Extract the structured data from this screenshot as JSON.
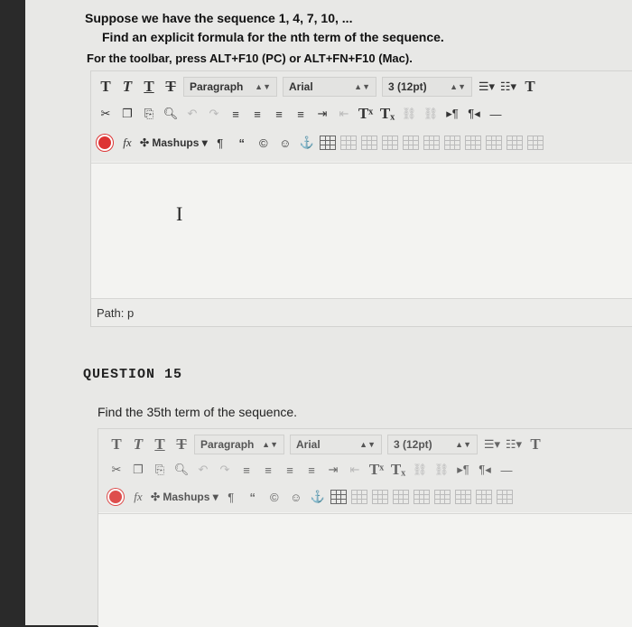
{
  "q1": {
    "line1": "Suppose we have the sequence 1, 4, 7, 10, ...",
    "line2": "Find an explicit formula for the nth term of the sequence.",
    "line3": "For the toolbar, press ALT+F10 (PC) or ALT+FN+F10 (Mac)."
  },
  "toolbar": {
    "format_select": "Paragraph",
    "font_select": "Arial",
    "size_select": "3 (12pt)",
    "mashups": "Mashups",
    "t_letter": "T",
    "symbol_pilcrow": "¶",
    "symbol_quote": "“",
    "symbol_copyright": "©",
    "symbol_smiley": "☺",
    "symbol_anchor": "⚓",
    "symbol_cut": "✂",
    "symbol_fx": "fx"
  },
  "editor1": {
    "path_label": "Path: p"
  },
  "q2": {
    "title": "QUESTION 15",
    "text": "Find the 35th term of the sequence."
  },
  "colors": {
    "page_bg": "#e8e8e6",
    "editor_bg": "#f2f2f0",
    "stop_red": "#d33333"
  }
}
